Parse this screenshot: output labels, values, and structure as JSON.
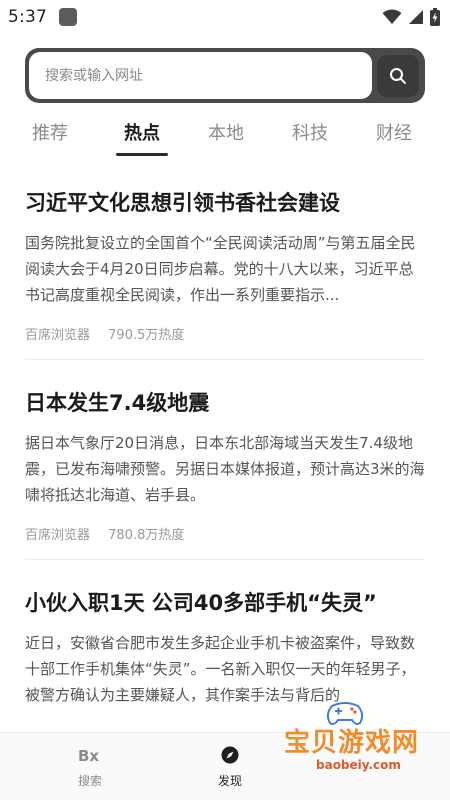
{
  "status_bar": {
    "time": "5:37"
  },
  "search": {
    "placeholder": "搜索或输入网址"
  },
  "tabs": [
    {
      "label": "推荐"
    },
    {
      "label": "热点"
    },
    {
      "label": "本地"
    },
    {
      "label": "科技"
    },
    {
      "label": "财经"
    }
  ],
  "articles": [
    {
      "title": "习近平文化思想引领书香社会建设",
      "summary": "国务院批复设立的全国首个“全民阅读活动周”与第五届全民阅读大会于4月20日同步启幕。党的十八大以来，习近平总书记高度重视全民阅读，作出一系列重要指示...",
      "source": "百席浏览器",
      "heat": "790.5万热度"
    },
    {
      "title": "日本发生7.4级地震",
      "summary": "据日本气象厅20日消息，日本东北部海域当天发生7.4级地震，已发布海啸预警。另据日本媒体报道，预计高达3米的海啸将抵达北海道、岩手县。",
      "source": "百席浏览器",
      "heat": "780.8万热度"
    },
    {
      "title": "小伙入职1天 公司40多部手机“失灵”",
      "summary": "近日，安徽省合肥市发生多起企业手机卡被盗案件，导致数十部工作手机集体“失灵”。一名新入职仅一天的年轻男子，被警方确认为主要嫌疑人，其作案手法与背后的",
      "source": "",
      "heat": ""
    }
  ],
  "bottom_nav": {
    "search_label": "搜索",
    "discover_label": "发现"
  },
  "watermark": {
    "name": "宝贝游戏网",
    "url": "baobeiy.com"
  },
  "colors": {
    "search_frame": "#4a4a4a",
    "active_tab": "#1a1a1a",
    "inactive_tab": "#8c8c8c",
    "watermark_orange": "#f08c2a"
  }
}
